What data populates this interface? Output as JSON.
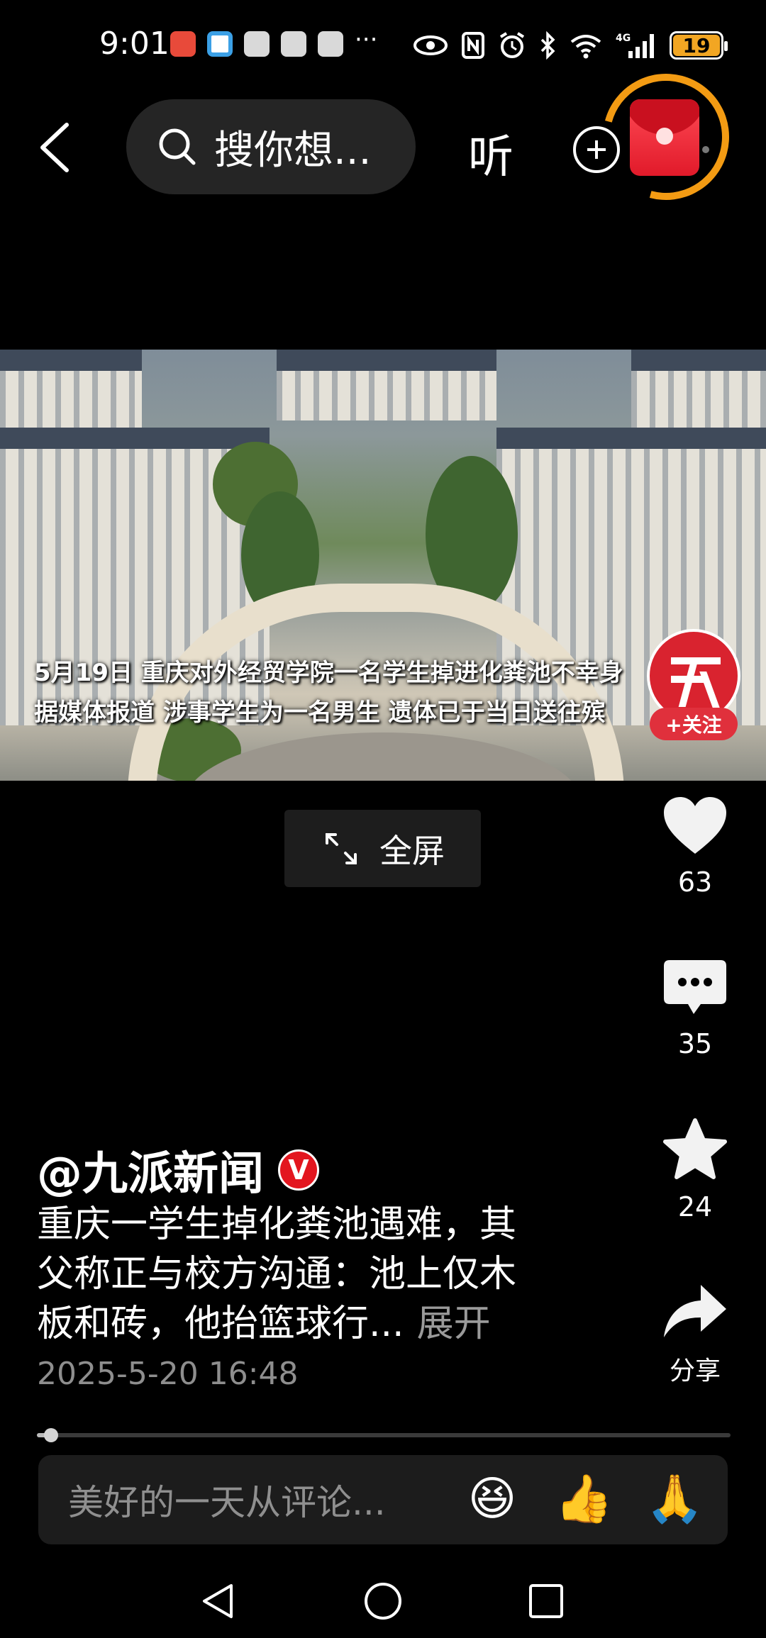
{
  "status_bar": {
    "time": "9:01",
    "more_indicator": "···",
    "battery_level": "19",
    "icons": [
      "eye-icon",
      "nfc-icon",
      "alarm-icon",
      "bluetooth-icon",
      "wifi-icon",
      "4g-signal-icon",
      "battery-icon"
    ]
  },
  "top_bar": {
    "search_placeholder": "搜你想...",
    "listen_label": "听",
    "icons": [
      "back-icon",
      "search-icon",
      "add-icon",
      "red-packet-icon"
    ]
  },
  "video": {
    "caption_line1": "5月19日 重庆对外经贸学院一名学生掉进化粪池不幸身",
    "caption_line2": "据媒体报道 涉事学生为一名男生 遗体已于当日送往殡",
    "follow_label": "+关注",
    "fullscreen_label": "全屏"
  },
  "actions": {
    "like_count": "63",
    "comment_count": "35",
    "favorite_count": "24",
    "share_label": "分享"
  },
  "post": {
    "author": "@九派新闻",
    "verified_badge": "V",
    "title_line1": "重庆一学生掉化粪池遇难，其",
    "title_line2": "父称正与校方沟通：池上仅木",
    "title_line3": "板和砖，他抬篮球行...",
    "expand_label": "展开",
    "datetime": "2025-5-20 16:48",
    "progress_fraction": 0.02
  },
  "comment_bar": {
    "placeholder": "美好的一天从评论...",
    "emojis": [
      "😆",
      "👍",
      "🙏"
    ]
  },
  "colors": {
    "background": "#000000",
    "accent_red": "#e3161f",
    "ring_orange": "#f39b13",
    "battery_fill": "#f2a623"
  }
}
